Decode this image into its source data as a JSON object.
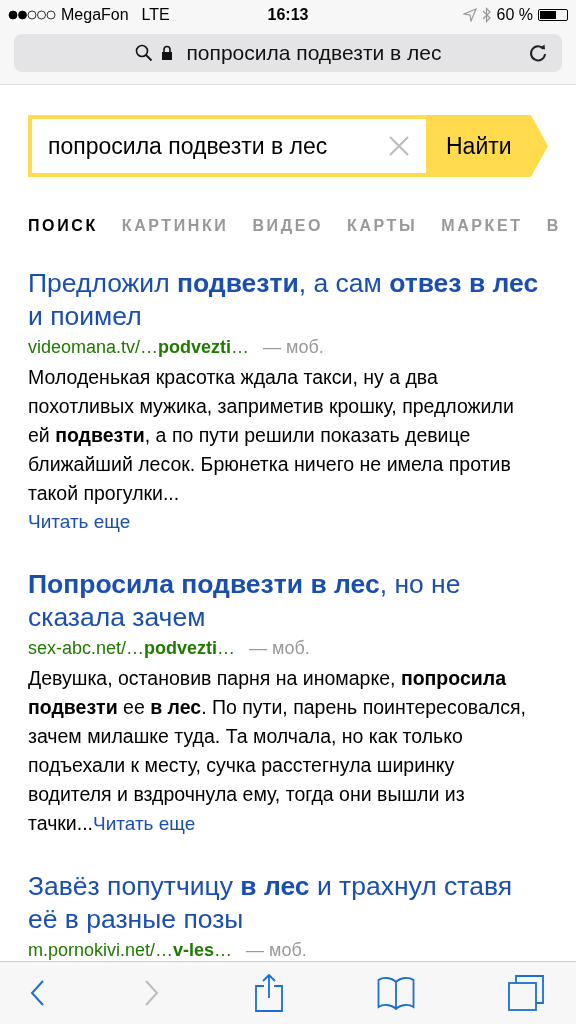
{
  "status_bar": {
    "carrier": "MegaFon",
    "network": "LTE",
    "time": "16:13",
    "battery": "60 %"
  },
  "address_bar": {
    "text": "попросила подвезти в лес"
  },
  "search": {
    "value": "попросила подвезти в лес",
    "button": "Найти"
  },
  "tabs": [
    {
      "label": "ПОИСК",
      "selected": true
    },
    {
      "label": "КАРТИНКИ",
      "selected": false
    },
    {
      "label": "ВИДЕО",
      "selected": false
    },
    {
      "label": "КАРТЫ",
      "selected": false
    },
    {
      "label": "МАРКЕТ",
      "selected": false
    },
    {
      "label": "В",
      "selected": false
    }
  ],
  "results": [
    {
      "title": "Предложил **подвезти**, а сам **отвез в лес** и поимел",
      "url": "videomana.tv/…**podvezti**…",
      "tag": "— моб.",
      "snippet": "Молоденькая красотка ждала такси, ну а два похотливых мужика, заприметив крошку, предложили ей **подвезти**, а по пути решили показать девице ближайший лесок. Брюнетка ничего не имела против такой прогулки...",
      "read_more": "Читать еще",
      "read_more_inline": false
    },
    {
      "title": "**Попросила подвезти в лес**, но не сказала зачем",
      "url": "sex-abc.net/…**podvezti**…",
      "tag": "— моб.",
      "snippet": "Девушка, остановив парня на иномарке, **попросила подвезти** ее **в лес**. По пути, парень поинтересовался, зачем милашке туда. Та молчала, но как только подъехали к месту, сучка расстегнула ширинку водителя и вздрочнула ему, тогда они вышли из тачки...",
      "read_more": "Читать еще",
      "read_more_inline": true
    },
    {
      "title": "Завёз попутчицу **в лес** и трахнул ставя её в разные позы",
      "url": "m.pornokivi.net/…**v-les**…",
      "tag": "— моб."
    }
  ],
  "toolbar": {
    "back_disabled": false,
    "forward_disabled": true
  }
}
